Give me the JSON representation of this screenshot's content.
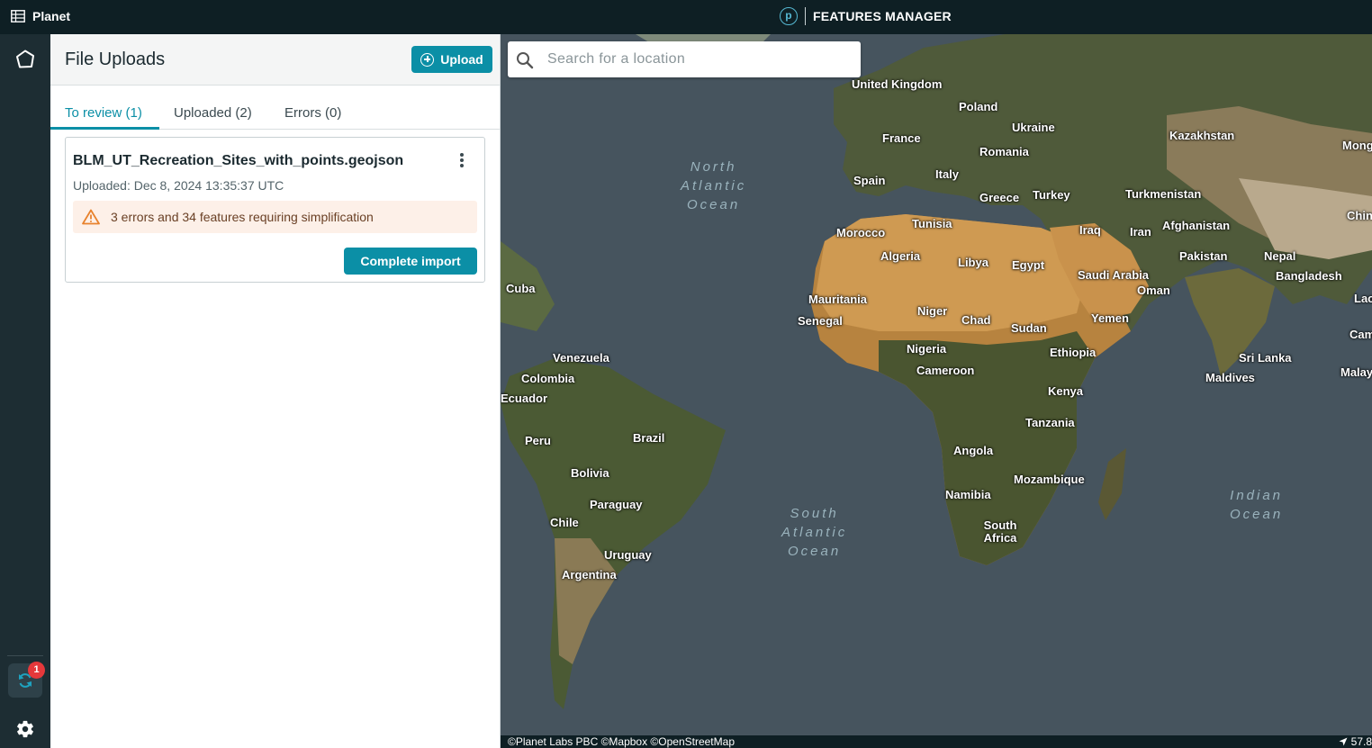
{
  "topbar": {
    "brand": "Planet",
    "brand_icon": "building-grid-icon",
    "logo_letter": "p",
    "title": "FEATURES MANAGER"
  },
  "rail": {
    "notification_count": "1",
    "badge_color": "#e5383b"
  },
  "panel": {
    "title": "File Uploads",
    "upload_label": "Upload",
    "tabs": [
      {
        "label": "To review (1)",
        "active": true
      },
      {
        "label": "Uploaded (2)",
        "active": false
      },
      {
        "label": "Errors (0)",
        "active": false
      }
    ],
    "card": {
      "filename": "BLM_UT_Recreation_Sites_with_points.geojson",
      "uploaded": "Uploaded: Dec 8, 2024 13:35:37 UTC",
      "warning": "3 errors and 34 features requiring simplification",
      "action": "Complete import"
    }
  },
  "map": {
    "search_placeholder": "Search for a location",
    "labels": [
      "United Kingdom",
      "Poland",
      "Ukraine",
      "Kazakhstan",
      "Mong",
      "France",
      "Romania",
      "Italy",
      "Spain",
      "Greece",
      "Turkey",
      "Turkmenistan",
      "Chin",
      "Tunisia",
      "Morocco",
      "Algeria",
      "Libya",
      "Egypt",
      "Iraq",
      "Iran",
      "Afghanistan",
      "Pakistan",
      "Nepal",
      "Bangladesh",
      "Saudi Arabia",
      "Oman",
      "Lao",
      "Cuba",
      "Mauritania",
      "Senegal",
      "Niger",
      "Chad",
      "Sudan",
      "Yemen",
      "Cam",
      "Nigeria",
      "Ethiopia",
      "Sri Lanka",
      "Venezuela",
      "Colombia",
      "Cameroon",
      "Malay",
      "Maldives",
      "Ecuador",
      "Kenya",
      "Tanzania",
      "Peru",
      "Brazil",
      "Angola",
      "Bolivia",
      "Mozambique",
      "Namibia",
      "Paraguay",
      "Chile",
      "South Africa",
      "Uruguay",
      "Argentina"
    ],
    "oceans": [
      "North Atlantic Ocean",
      "South Atlantic Ocean",
      "Indian Ocean"
    ],
    "attribution": "©Planet Labs PBC ©Mapbox ©OpenStreetMap",
    "scale_value": "57.8",
    "ocean_color": "#46545e"
  }
}
